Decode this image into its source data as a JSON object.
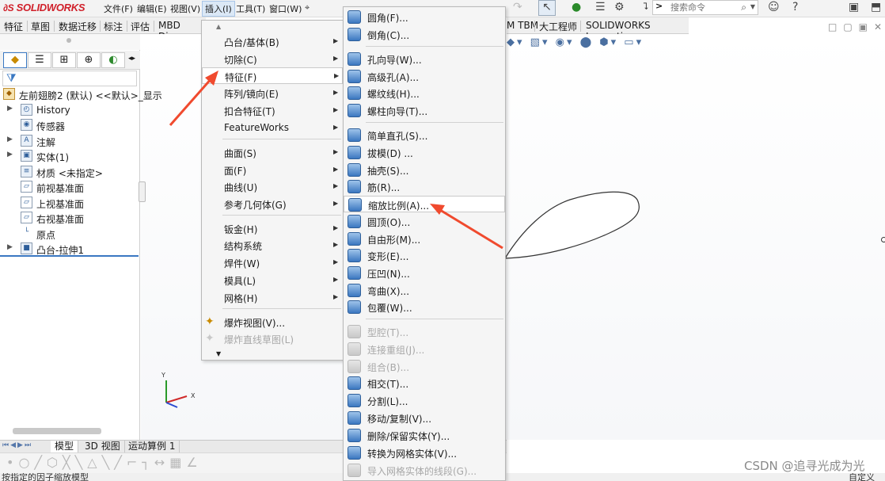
{
  "app": {
    "logo_prefix": "∂S",
    "logo_text": "SOLIDWORKS"
  },
  "menubar": {
    "items": [
      {
        "label": "文件(F)"
      },
      {
        "label": "编辑(E)"
      },
      {
        "label": "视图(V)"
      },
      {
        "label": "插入(I)"
      },
      {
        "label": "工具(T)"
      },
      {
        "label": "窗口(W)"
      }
    ]
  },
  "search": {
    "placeholder": "搜索命令",
    "prompt_glyph": ">"
  },
  "command_tabs": [
    {
      "label": "特征"
    },
    {
      "label": "草图"
    },
    {
      "label": "数据迁移"
    },
    {
      "label": "标注"
    },
    {
      "label": "评估"
    },
    {
      "label": "MBD Dime"
    }
  ],
  "command_tabs_right": [
    {
      "label": "M TBM"
    },
    {
      "label": "大工程师"
    },
    {
      "label": "SOLIDWORKS Inspection"
    }
  ],
  "feature_tree": {
    "root": "左前翅膀2 (默认) <<默认>_显示",
    "items": [
      {
        "label": "History",
        "expandable": true,
        "icon": "history-icon"
      },
      {
        "label": "传感器",
        "expandable": false,
        "icon": "sensor-icon"
      },
      {
        "label": "注解",
        "expandable": true,
        "icon": "annotation-icon"
      },
      {
        "label": "实体(1)",
        "expandable": true,
        "icon": "solid-body-icon"
      },
      {
        "label": "材质 <未指定>",
        "expandable": false,
        "icon": "material-icon"
      },
      {
        "label": "前视基准面",
        "expandable": false,
        "icon": "plane-icon"
      },
      {
        "label": "上视基准面",
        "expandable": false,
        "icon": "plane-icon"
      },
      {
        "label": "右视基准面",
        "expandable": false,
        "icon": "plane-icon"
      },
      {
        "label": "原点",
        "expandable": false,
        "icon": "origin-icon"
      },
      {
        "label": "凸台-拉伸1",
        "expandable": true,
        "icon": "extrude-icon"
      }
    ]
  },
  "insert_menu": {
    "items": [
      {
        "label": "凸台/基体(B)",
        "submenu": true
      },
      {
        "label": "切除(C)",
        "submenu": true
      },
      {
        "label": "特征(F)",
        "submenu": true,
        "highlighted": true
      },
      {
        "label": "阵列/镜向(E)",
        "submenu": true
      },
      {
        "label": "扣合特征(T)",
        "submenu": true
      },
      {
        "label": "FeatureWorks",
        "submenu": true
      },
      {
        "label": "曲面(S)",
        "submenu": true
      },
      {
        "label": "面(F)",
        "submenu": true
      },
      {
        "label": "曲线(U)",
        "submenu": true
      },
      {
        "label": "参考几何体(G)",
        "submenu": true
      },
      {
        "label": "钣金(H)",
        "submenu": true
      },
      {
        "label": "结构系统",
        "submenu": true
      },
      {
        "label": "焊件(W)",
        "submenu": true
      },
      {
        "label": "模具(L)",
        "submenu": true
      },
      {
        "label": "网格(H)",
        "submenu": true
      },
      {
        "label": "爆炸视图(V)...",
        "submenu": false
      },
      {
        "label": "爆炸直线草图(L)",
        "submenu": false,
        "disabled": true
      }
    ]
  },
  "feature_menu": {
    "items": [
      {
        "label": "圆角(F)..."
      },
      {
        "label": "倒角(C)..."
      },
      {
        "label": "孔向导(W)..."
      },
      {
        "label": "高级孔(A)..."
      },
      {
        "label": "螺纹线(H)..."
      },
      {
        "label": "螺柱向导(T)..."
      },
      {
        "label": "简单直孔(S)..."
      },
      {
        "label": "拔模(D) ..."
      },
      {
        "label": "抽壳(S)..."
      },
      {
        "label": "筋(R)..."
      },
      {
        "label": "缩放比例(A)...",
        "highlighted": true
      },
      {
        "label": "圆顶(O)..."
      },
      {
        "label": "自由形(M)..."
      },
      {
        "label": "变形(E)..."
      },
      {
        "label": "压凹(N)..."
      },
      {
        "label": "弯曲(X)..."
      },
      {
        "label": "包覆(W)..."
      },
      {
        "label": "型腔(T)...",
        "disabled": true
      },
      {
        "label": "连接重组(J)...",
        "disabled": true
      },
      {
        "label": "组合(B)...",
        "disabled": true
      },
      {
        "label": "相交(T)..."
      },
      {
        "label": "分割(L)..."
      },
      {
        "label": "移动/复制(V)..."
      },
      {
        "label": "删除/保留实体(Y)..."
      },
      {
        "label": "转换为网格实体(V)..."
      },
      {
        "label": "导入网格实体的线段(G)...",
        "disabled": true
      }
    ]
  },
  "bottom_tabs": [
    {
      "label": "模型",
      "active": true
    },
    {
      "label": "3D 视图"
    },
    {
      "label": "运动算例 1"
    }
  ],
  "status": {
    "left": "按指定的因子缩放模型",
    "right": "自定义"
  },
  "triad": {
    "x_label": "X",
    "y_label": "Y"
  },
  "watermark": "CSDN @追寻光成为光",
  "colors": {
    "accent_blue": "#3a78c2",
    "logo_red": "#d0202a",
    "annotation_arrow": "#f04a2e"
  }
}
